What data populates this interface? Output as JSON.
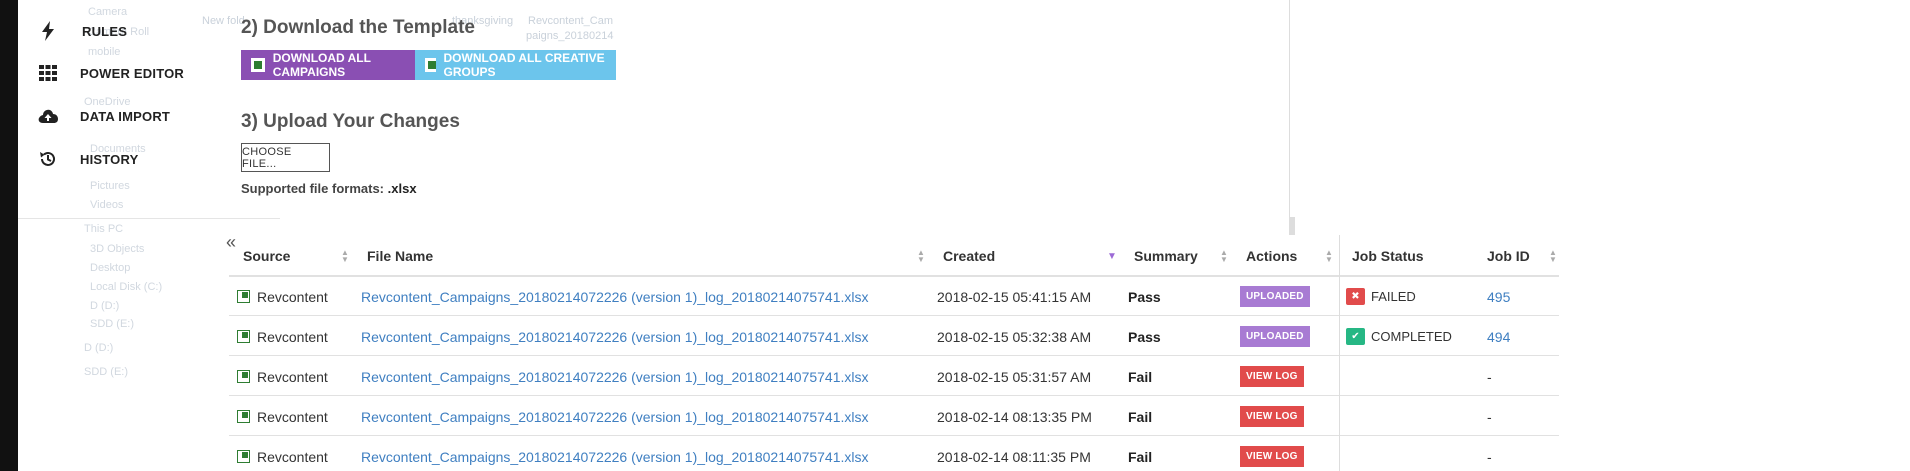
{
  "sidebar": {
    "items": [
      {
        "label": "RULES",
        "icon": "bolt-icon"
      },
      {
        "label": "POWER EDITOR",
        "icon": "grid-icon"
      },
      {
        "label": "DATA IMPORT",
        "icon": "cloud-upload-icon"
      },
      {
        "label": "HISTORY",
        "icon": "history-icon"
      }
    ],
    "collapse_glyph": "«"
  },
  "background_ghost": {
    "left": [
      "Camera",
      "Camera Roll",
      "mobile",
      "OneDrive",
      "Documents",
      "Pictures",
      "Videos",
      "This PC",
      "3D Objects",
      "Desktop",
      "Local Disk (C:)",
      "D (D:)",
      "SDD (E:)",
      "D (D:)",
      "SDD (E:)"
    ],
    "top": [
      "New fold",
      "thanksgiving",
      "Revcontent_Cam",
      "paigns_20180214"
    ]
  },
  "step2": {
    "title": "2) Download the Template",
    "download_campaigns_label": "DOWNLOAD ALL CAMPAIGNS",
    "download_groups_label": "DOWNLOAD ALL CREATIVE GROUPS"
  },
  "step3": {
    "title": "3) Upload Your Changes",
    "choose_label": "CHOOSE FILE...",
    "formats_prefix": "Supported file formats:",
    "formats_value": ".xlsx"
  },
  "table": {
    "headers": {
      "source": "Source",
      "file_name": "File Name",
      "created": "Created",
      "summary": "Summary",
      "actions": "Actions",
      "job_status": "Job Status",
      "job_id": "Job ID"
    },
    "rows": [
      {
        "source": "Revcontent",
        "file": "Revcontent_Campaigns_20180214072226 (version 1)_log_20180214075741.xlsx",
        "created": "2018-02-15 05:41:15 AM",
        "summary": "Pass",
        "action": "UPLOADED",
        "status": "FAILED",
        "job_id": "495"
      },
      {
        "source": "Revcontent",
        "file": "Revcontent_Campaigns_20180214072226 (version 1)_log_20180214075741.xlsx",
        "created": "2018-02-15 05:32:38 AM",
        "summary": "Pass",
        "action": "UPLOADED",
        "status": "COMPLETED",
        "job_id": "494"
      },
      {
        "source": "Revcontent",
        "file": "Revcontent_Campaigns_20180214072226 (version 1)_log_20180214075741.xlsx",
        "created": "2018-02-15 05:31:57 AM",
        "summary": "Fail",
        "action": "VIEW LOG",
        "status": "",
        "job_id": "-"
      },
      {
        "source": "Revcontent",
        "file": "Revcontent_Campaigns_20180214072226 (version 1)_log_20180214075741.xlsx",
        "created": "2018-02-14 08:13:35 PM",
        "summary": "Fail",
        "action": "VIEW LOG",
        "status": "",
        "job_id": "-"
      },
      {
        "source": "Revcontent",
        "file": "Revcontent_Campaigns_20180214072226 (version 1)_log_20180214075741.xlsx",
        "created": "2018-02-14 08:11:35 PM",
        "summary": "Fail",
        "action": "VIEW LOG",
        "status": "",
        "job_id": "-"
      }
    ]
  },
  "colors": {
    "purple_button": "#8a4fb3",
    "blue_button": "#6cc5ec",
    "uploaded_badge": "#a87bd3",
    "view_log_badge": "#e14b4b",
    "completed_status": "#26b784",
    "link": "#3f7fc1"
  }
}
